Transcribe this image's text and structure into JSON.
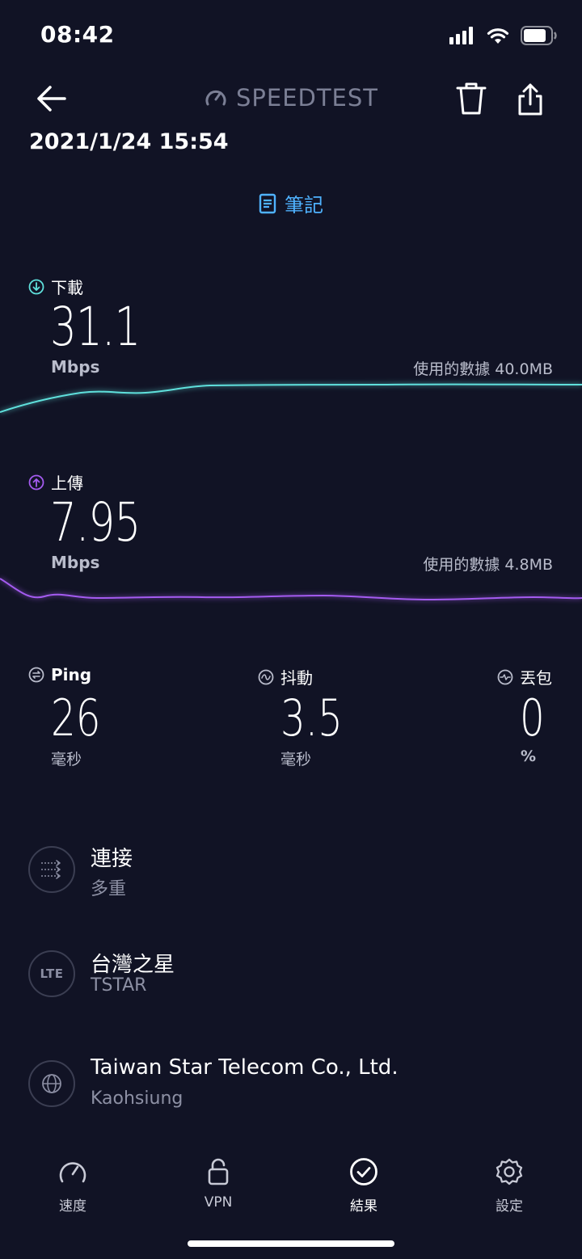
{
  "status_bar": {
    "time": "08:42"
  },
  "header": {
    "brand": "SPEEDTEST",
    "date": "2021/1/24 15:54",
    "notes_label": "筆記"
  },
  "download": {
    "label": "下載",
    "value": "31.1",
    "unit": "Mbps",
    "data_used": "使用的數據 40.0MB",
    "color": "#5fe0dc"
  },
  "upload": {
    "label": "上傳",
    "value": "7.95",
    "unit": "Mbps",
    "data_used": "使用的數據 4.8MB",
    "color": "#a45bf0"
  },
  "ping": {
    "label": "Ping",
    "value": "26",
    "unit": "毫秒"
  },
  "jitter": {
    "label": "抖動",
    "value": "3.5",
    "unit": "毫秒"
  },
  "packet_loss": {
    "label": "丟包",
    "value": "0",
    "unit": "%"
  },
  "connection": {
    "title": "連接",
    "subtitle": "多重"
  },
  "provider": {
    "icon_label": "LTE",
    "title": "台灣之星",
    "subtitle": "TSTAR"
  },
  "server": {
    "title": "Taiwan Star Telecom Co., Ltd.",
    "subtitle": "Kaohsiung"
  },
  "tabs": [
    {
      "label": "速度",
      "icon": "speedometer-icon"
    },
    {
      "label": "VPN",
      "icon": "lock-icon"
    },
    {
      "label": "結果",
      "icon": "check-circle-icon"
    },
    {
      "label": "設定",
      "icon": "gear-icon"
    }
  ]
}
